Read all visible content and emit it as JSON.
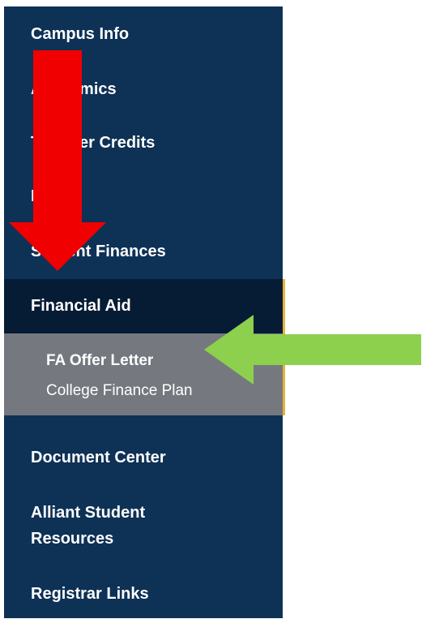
{
  "nav": {
    "items": [
      {
        "label": "Campus Info"
      },
      {
        "label": "Academics"
      },
      {
        "label": "Transfer Credits"
      },
      {
        "label": "Profile"
      },
      {
        "label": "Student Finances"
      },
      {
        "label": "Financial Aid"
      },
      {
        "label": "Document Center"
      },
      {
        "label": "Alliant Student Resources"
      },
      {
        "label": "Registrar Links"
      }
    ],
    "active_item": "Financial Aid",
    "submenu": [
      {
        "label": "FA Offer Letter",
        "current": true
      },
      {
        "label": "College Finance Plan",
        "current": false
      }
    ]
  },
  "colors": {
    "sidebar": "#0e3156",
    "active_item": "#061c34",
    "submenu": "#75797f",
    "accent_border": "#e4b23a",
    "red_arrow": "#f00000",
    "green_arrow": "#8cd04e"
  },
  "annotations": [
    {
      "icon": "red-down-arrow-icon"
    },
    {
      "icon": "green-left-arrow-icon"
    }
  ]
}
